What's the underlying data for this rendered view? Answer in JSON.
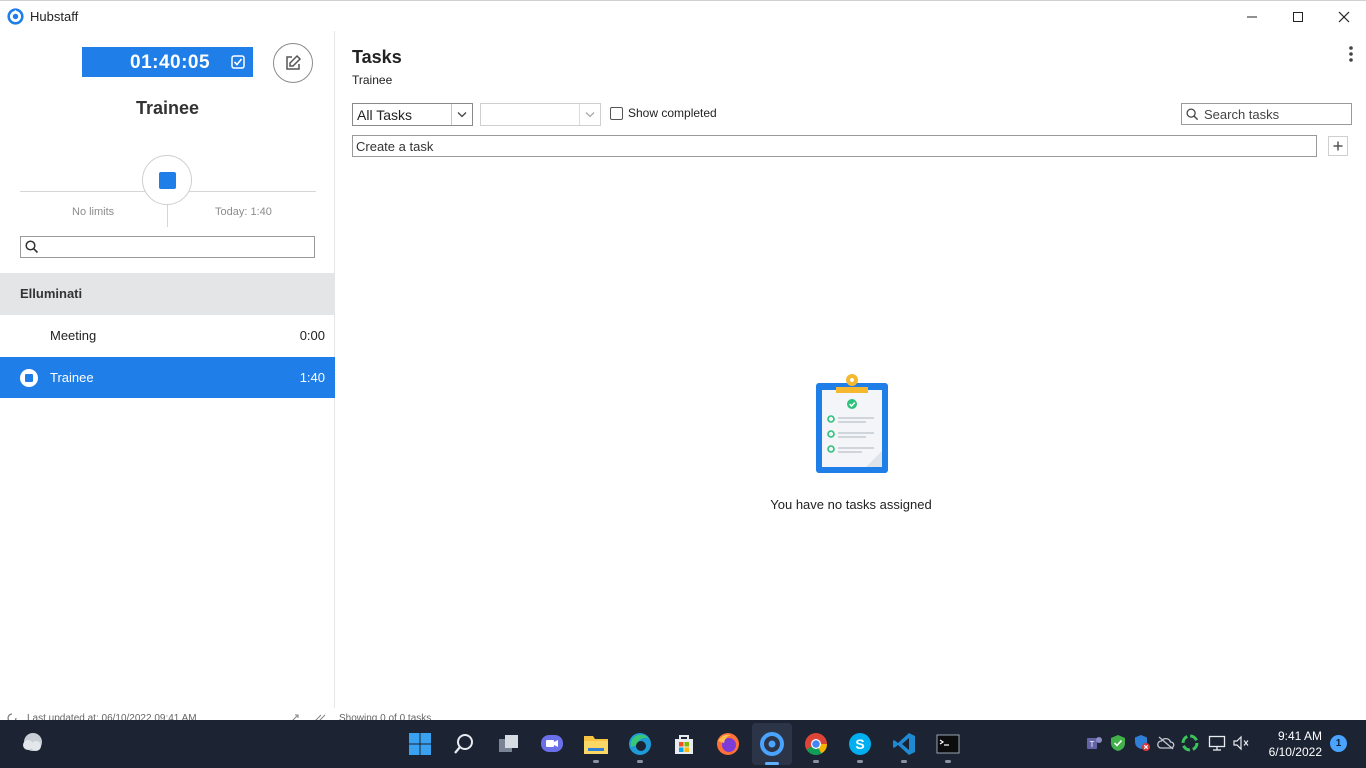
{
  "window": {
    "title": "Hubstaff"
  },
  "left": {
    "timer": "01:40:05",
    "project_name": "Trainee",
    "limits_label": "No limits",
    "today_label": "Today: 1:40",
    "search_placeholder": "",
    "organization": "Elluminati",
    "tasks": [
      {
        "label": "Meeting",
        "time": "0:00",
        "active": false
      },
      {
        "label": "Trainee",
        "time": "1:40",
        "active": true
      }
    ]
  },
  "main": {
    "title": "Tasks",
    "subtitle": "Trainee",
    "filter_selected": "All Tasks",
    "second_filter": "",
    "show_completed_label": "Show completed",
    "search_placeholder": "Search tasks",
    "create_placeholder": "Create a task",
    "empty_message": "You have no tasks assigned"
  },
  "status": {
    "last_updated": "Last updated at: 06/10/2022 09:41 AM",
    "showing": "Showing 0 of 0 tasks"
  },
  "taskbar": {
    "time": "9:41 AM",
    "date": "6/10/2022",
    "notification_count": "1"
  },
  "colors": {
    "accent": "#1f7ee8",
    "taskbar": "#1c2433"
  }
}
